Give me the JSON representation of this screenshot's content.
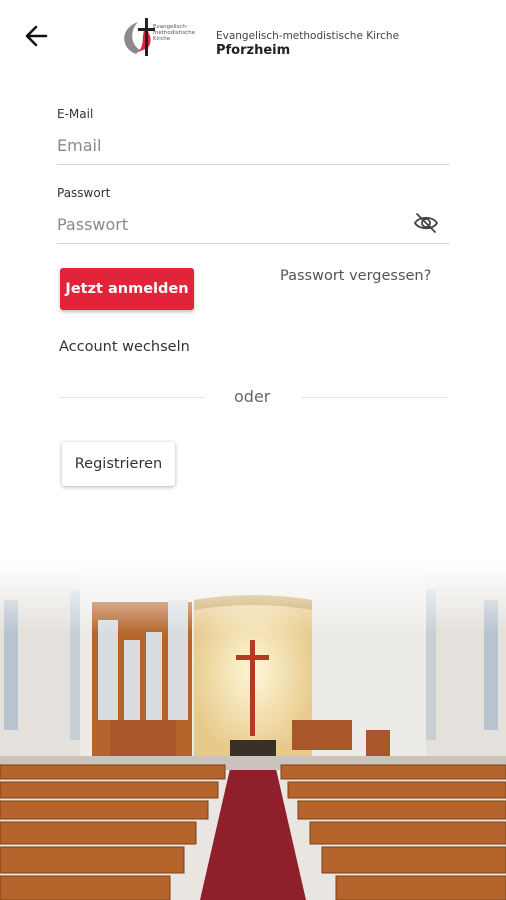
{
  "header": {
    "org_small_text": "Evangelisch-methodistische Kirche",
    "org_name": "Evangelisch-methodistische Kirche",
    "org_location": "Pforzheim"
  },
  "form": {
    "email_label": "E-Mail",
    "email_placeholder": "Email",
    "password_label": "Passwort",
    "password_placeholder": "Passwort"
  },
  "actions": {
    "login_label": "Jetzt anmelden",
    "forgot_label": "Passwort vergessen?",
    "switch_account_label": "Account wechseln",
    "or_label": "oder",
    "register_label": "Registrieren"
  },
  "colors": {
    "primary": "#e2243a",
    "aisle_carpet": "#8e1f2b",
    "pew_wood": "#b5652c"
  },
  "icons": {
    "back": "arrow-left-icon",
    "password_toggle": "eye-off-icon",
    "logo": "cross-and-flame-icon"
  }
}
